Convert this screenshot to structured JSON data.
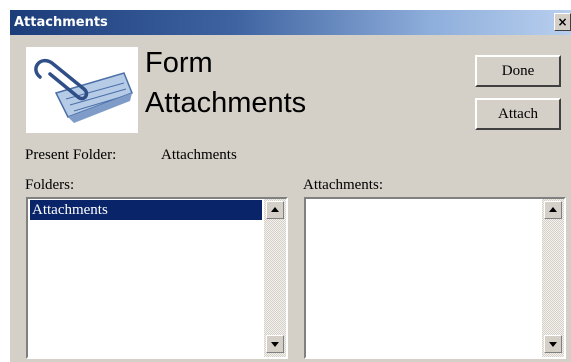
{
  "window": {
    "title": "Attachments",
    "close_glyph": "×"
  },
  "header": {
    "line1": "Form",
    "line2": "Attachments",
    "logo_icon": "paperclip-document-icon"
  },
  "buttons": {
    "done": "Done",
    "attach": "Attach"
  },
  "present_folder": {
    "label": "Present Folder:",
    "value": "Attachments"
  },
  "folders": {
    "label": "Folders:",
    "items": [
      "Attachments"
    ],
    "selected": "Attachments"
  },
  "attachments": {
    "label": "Attachments:",
    "items": []
  },
  "colors": {
    "title_bar_start": "#1b3d7a",
    "face": "#d4d0c8",
    "selection": "#0a246a"
  }
}
